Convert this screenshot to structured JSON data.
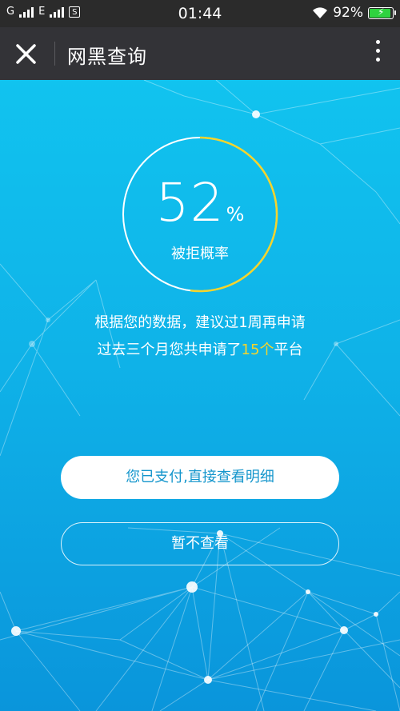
{
  "status_bar": {
    "network1": "G",
    "network2": "E",
    "sim_badge": "S",
    "time": "01:44",
    "battery_percent": "92%"
  },
  "header": {
    "title": "网黑查询"
  },
  "gauge": {
    "value": 52,
    "value_text": "52",
    "unit": "%",
    "label": "被拒概率"
  },
  "messages": {
    "line1": "根据您的数据，建议过1周再申请",
    "line2_prefix": "过去三个月您共申请了",
    "line2_count": "15个",
    "line2_suffix": "平台"
  },
  "buttons": {
    "primary": "您已支付,直接查看明细",
    "secondary": "暂不查看"
  },
  "colors": {
    "accent_yellow": "#f6d42b",
    "primary_text_blue": "#1596cc",
    "battery_green": "#2fd33f"
  }
}
